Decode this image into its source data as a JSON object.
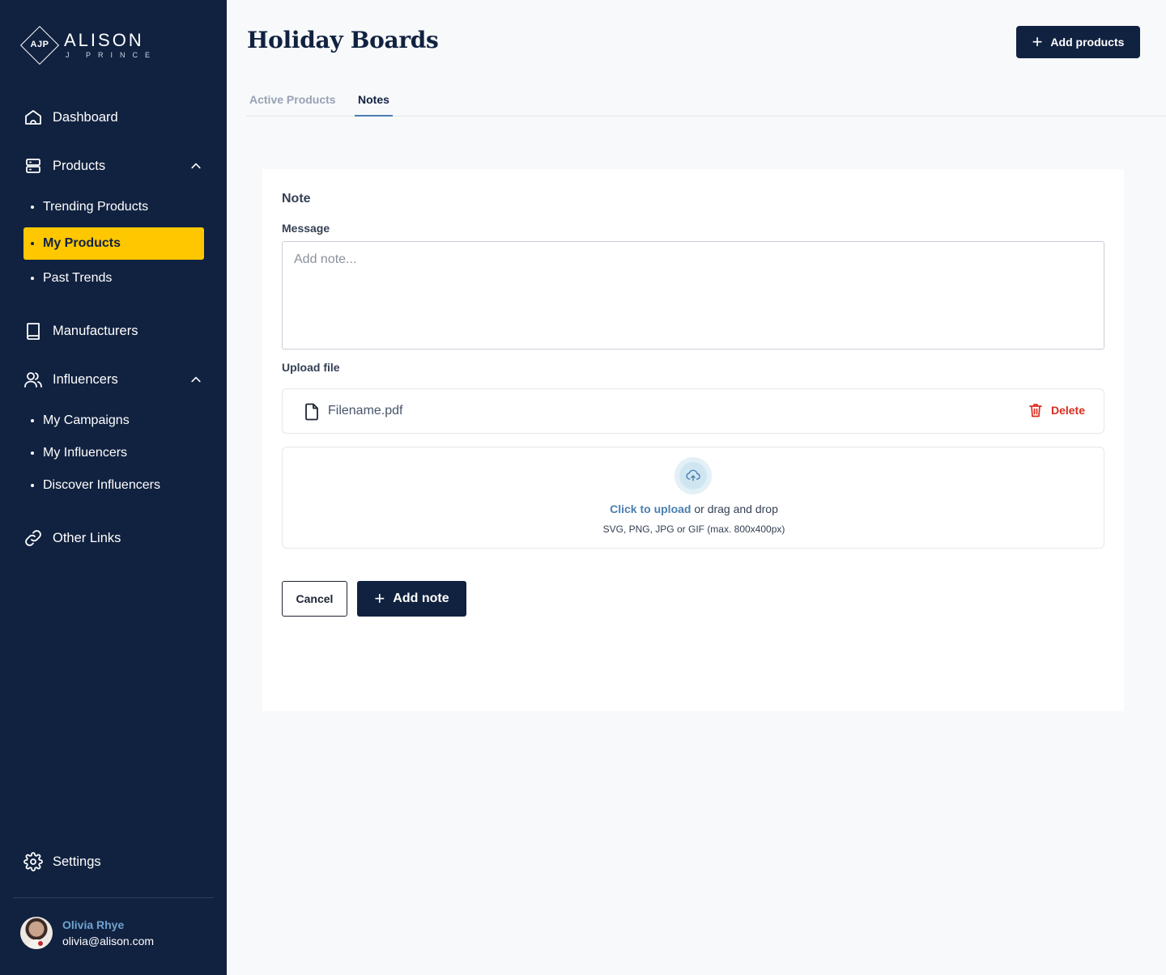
{
  "brand": {
    "monogram": "AJP",
    "name_line1": "ALISON",
    "name_line2": "J PRINCE"
  },
  "sidebar": {
    "nav": {
      "dashboard": "Dashboard",
      "products": "Products",
      "manufacturers": "Manufacturers",
      "influencers": "Influencers",
      "other_links": "Other Links",
      "settings": "Settings"
    },
    "products_sub": [
      "Trending Products",
      "My Products",
      "Past Trends"
    ],
    "influencers_sub": [
      "My Campaigns",
      "My Influencers",
      "Discover Influencers"
    ],
    "active_item": "My Products",
    "active_color": "#ffc700",
    "background_color": "#112240"
  },
  "user": {
    "name": "Olivia Rhye",
    "email": "olivia@alison.com"
  },
  "header": {
    "title": "Holiday Boards",
    "add_products_label": "Add products"
  },
  "tabs": [
    "Active Products",
    "Notes"
  ],
  "active_tab": "Notes",
  "note_form": {
    "heading": "Note",
    "message_label": "Message",
    "message_placeholder": "Add note...",
    "message_value": "",
    "upload_label": "Upload file",
    "file_name": "Filename.pdf",
    "delete_label": "Delete",
    "upload_link": "Click to upload",
    "upload_rest": " or drag and drop",
    "upload_hint": "SVG, PNG, JPG or GIF (max. 800x400px)",
    "cancel_label": "Cancel",
    "add_note_label": "Add note"
  },
  "icons": {
    "dashboard": "home-icon",
    "products": "server-icon",
    "manufacturers": "book-icon",
    "influencers": "users-icon",
    "other_links": "link-icon",
    "settings": "gear-icon",
    "file": "file-icon",
    "delete": "trash-icon",
    "upload": "upload-cloud-icon",
    "plus": "plus-icon",
    "chevron": "chevron-up-icon"
  },
  "colors": {
    "primary": "#112240",
    "accent": "#ffc700",
    "link": "#4a7fb0",
    "danger": "#d92d20"
  }
}
